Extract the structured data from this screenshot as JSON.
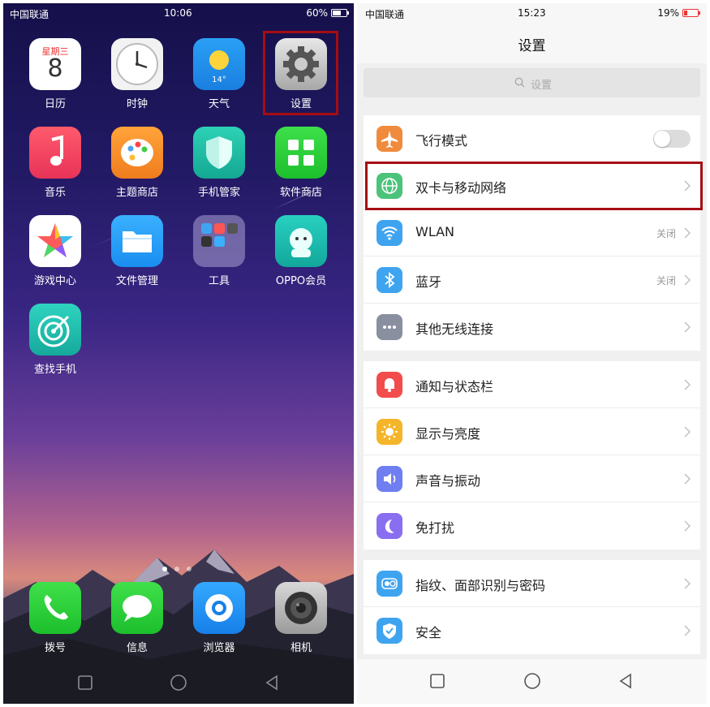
{
  "left_screen": {
    "status_bar": {
      "carrier": "中国联通",
      "time": "10:06",
      "battery": "60%"
    },
    "apps": [
      {
        "label": "日历",
        "icon": "calendar-icon",
        "weekday": "星期三",
        "day": "8"
      },
      {
        "label": "时钟",
        "icon": "clock-icon"
      },
      {
        "label": "天气",
        "icon": "weather-icon",
        "temp": "14°"
      },
      {
        "label": "设置",
        "icon": "settings-gear-icon"
      },
      {
        "label": "音乐",
        "icon": "music-note-icon"
      },
      {
        "label": "主题商店",
        "icon": "theme-palette-icon"
      },
      {
        "label": "手机管家",
        "icon": "shield-icon"
      },
      {
        "label": "软件商店",
        "icon": "app-store-icon"
      },
      {
        "label": "游戏中心",
        "icon": "game-star-icon"
      },
      {
        "label": "文件管理",
        "icon": "folder-icon"
      },
      {
        "label": "工具",
        "icon": "tools-folder-icon"
      },
      {
        "label": "OPPO会员",
        "icon": "oppo-member-icon"
      },
      {
        "label": "查找手机",
        "icon": "radar-icon"
      }
    ],
    "dock": [
      {
        "label": "拨号",
        "icon": "phone-icon"
      },
      {
        "label": "信息",
        "icon": "message-icon"
      },
      {
        "label": "浏览器",
        "icon": "browser-icon"
      },
      {
        "label": "相机",
        "icon": "camera-icon"
      }
    ],
    "page_dots": 3,
    "active_page": 1
  },
  "right_screen": {
    "status_bar": {
      "carrier": "中国联通",
      "time": "15:23",
      "battery": "19%"
    },
    "title": "设置",
    "search_placeholder": "设置",
    "groups": [
      [
        {
          "label": "飞行模式",
          "icon": "airplane-icon",
          "color": "#f08a3c",
          "control": "toggle",
          "toggle_on": false
        },
        {
          "label": "双卡与移动网络",
          "icon": "globe-icon",
          "color": "#4cc37b",
          "control": "chevron"
        },
        {
          "label": "WLAN",
          "icon": "wifi-icon",
          "color": "#3fa4f0",
          "control": "chevron",
          "value": "关闭"
        },
        {
          "label": "蓝牙",
          "icon": "bluetooth-icon",
          "color": "#3fa4f0",
          "control": "chevron",
          "value": "关闭"
        },
        {
          "label": "其他无线连接",
          "icon": "more-dots-icon",
          "color": "#8a8fa0",
          "control": "chevron"
        }
      ],
      [
        {
          "label": "通知与状态栏",
          "icon": "notification-bell-icon",
          "color": "#f24c4c",
          "control": "chevron"
        },
        {
          "label": "显示与亮度",
          "icon": "brightness-sun-icon",
          "color": "#f5b52a",
          "control": "chevron"
        },
        {
          "label": "声音与振动",
          "icon": "speaker-icon",
          "color": "#6f7ef0",
          "control": "chevron"
        },
        {
          "label": "免打扰",
          "icon": "moon-icon",
          "color": "#8a6ef0",
          "control": "chevron"
        }
      ],
      [
        {
          "label": "指纹、面部识别与密码",
          "icon": "fingerprint-face-icon",
          "color": "#3fa4f0",
          "control": "chevron"
        },
        {
          "label": "安全",
          "icon": "security-shield-icon",
          "color": "#3fa4f0",
          "control": "chevron"
        }
      ]
    ]
  },
  "annotation_color": "#a50d12"
}
